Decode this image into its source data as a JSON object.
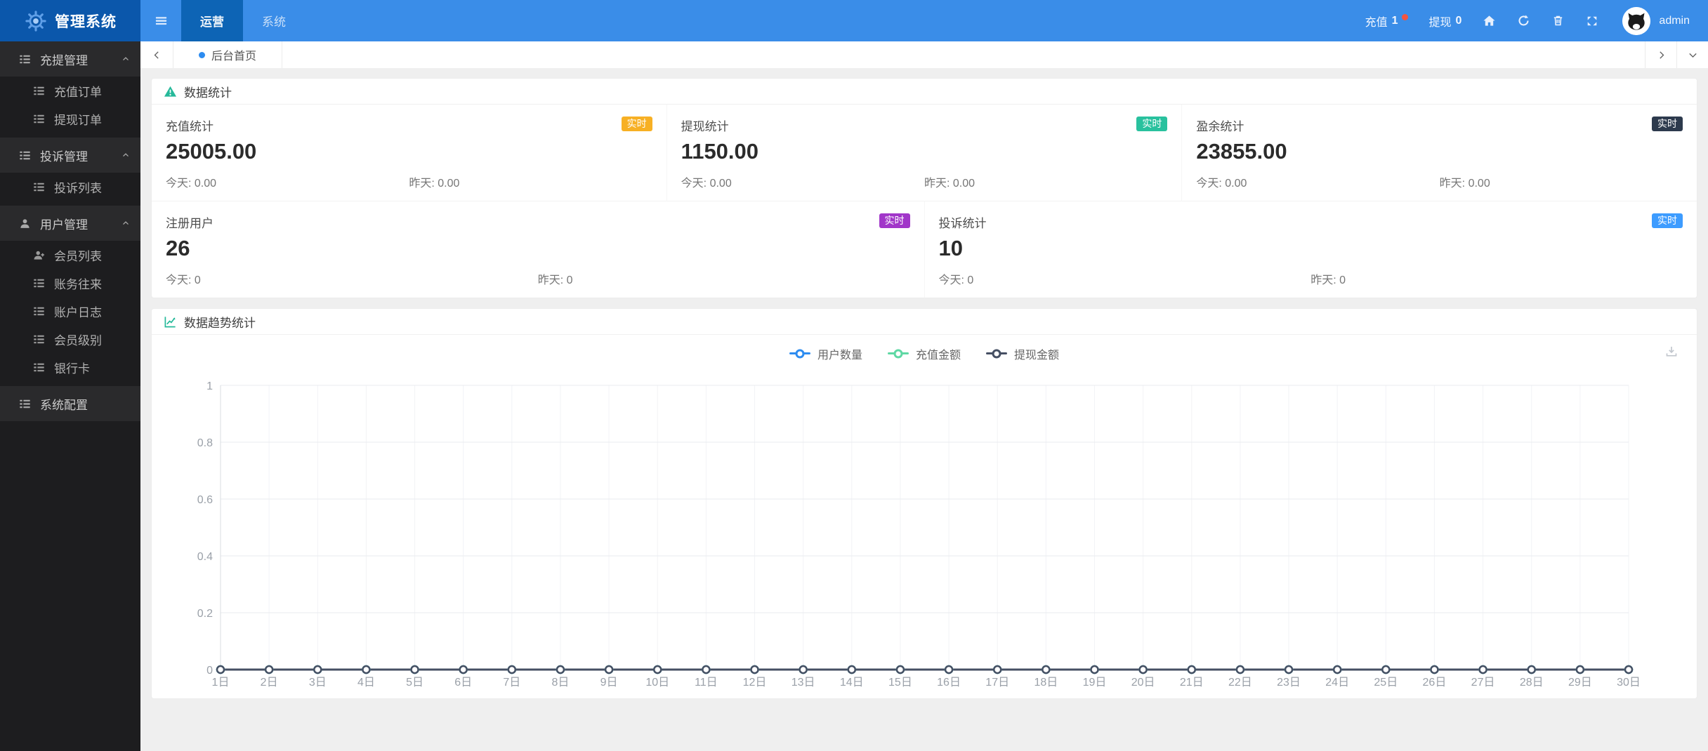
{
  "topbar": {
    "brand": "管理系统",
    "menu": [
      {
        "label": "运营",
        "active": true
      },
      {
        "label": "系统",
        "active": false
      }
    ],
    "recharge": {
      "label": "充值",
      "count": "1"
    },
    "withdraw": {
      "label": "提现",
      "count": "0"
    },
    "username": "admin"
  },
  "tabbar": {
    "active_tab": "后台首页"
  },
  "sidebar": {
    "sections": [
      {
        "label": "充提管理",
        "children": [
          {
            "label": "充值订单"
          },
          {
            "label": "提现订单"
          }
        ]
      },
      {
        "label": "投诉管理",
        "children": [
          {
            "label": "投诉列表"
          }
        ]
      },
      {
        "label": "用户管理",
        "children": [
          {
            "label": "会员列表"
          },
          {
            "label": "账务往来"
          },
          {
            "label": "账户日志"
          },
          {
            "label": "会员级别"
          },
          {
            "label": "银行卡"
          }
        ]
      },
      {
        "label": "系统配置",
        "children": []
      }
    ]
  },
  "stats_panel": {
    "title": "数据统计",
    "today_label": "今天:",
    "yesterday_label": "昨天:",
    "badge_label": "实时",
    "cards": [
      {
        "label": "充值统计",
        "value": "25005.00",
        "today": "0.00",
        "yesterday": "0.00",
        "badge_color": "#f7b024"
      },
      {
        "label": "提现统计",
        "value": "1150.00",
        "today": "0.00",
        "yesterday": "0.00",
        "badge_color": "#29c19e"
      },
      {
        "label": "盈余统计",
        "value": "23855.00",
        "today": "0.00",
        "yesterday": "0.00",
        "badge_color": "#2d3a4d"
      },
      {
        "label": "注册用户",
        "value": "26",
        "today": "0",
        "yesterday": "0",
        "badge_color": "#a136c9"
      },
      {
        "label": "投诉统计",
        "value": "10",
        "today": "0",
        "yesterday": "0",
        "badge_color": "#3d9cff"
      }
    ]
  },
  "chart_panel": {
    "title": "数据趋势统计"
  },
  "chart_data": {
    "type": "line",
    "title": "数据趋势统计",
    "categories": [
      "1日",
      "2日",
      "3日",
      "4日",
      "5日",
      "6日",
      "7日",
      "8日",
      "9日",
      "10日",
      "11日",
      "12日",
      "13日",
      "14日",
      "15日",
      "16日",
      "17日",
      "18日",
      "19日",
      "20日",
      "21日",
      "22日",
      "23日",
      "24日",
      "25日",
      "26日",
      "27日",
      "28日",
      "29日",
      "30日"
    ],
    "series": [
      {
        "name": "用户数量",
        "color": "#2d8cf0",
        "values": [
          0,
          0,
          0,
          0,
          0,
          0,
          0,
          0,
          0,
          0,
          0,
          0,
          0,
          0,
          0,
          0,
          0,
          0,
          0,
          0,
          0,
          0,
          0,
          0,
          0,
          0,
          0,
          0,
          0,
          0
        ]
      },
      {
        "name": "充值金额",
        "color": "#5fd8a4",
        "values": [
          0,
          0,
          0,
          0,
          0,
          0,
          0,
          0,
          0,
          0,
          0,
          0,
          0,
          0,
          0,
          0,
          0,
          0,
          0,
          0,
          0,
          0,
          0,
          0,
          0,
          0,
          0,
          0,
          0,
          0
        ]
      },
      {
        "name": "提现金额",
        "color": "#454f63",
        "values": [
          0,
          0,
          0,
          0,
          0,
          0,
          0,
          0,
          0,
          0,
          0,
          0,
          0,
          0,
          0,
          0,
          0,
          0,
          0,
          0,
          0,
          0,
          0,
          0,
          0,
          0,
          0,
          0,
          0,
          0
        ]
      }
    ],
    "xlabel": "",
    "ylabel": "",
    "ylim": [
      0,
      1
    ],
    "yticks": [
      0,
      0.2,
      0.4,
      0.6,
      0.8,
      1
    ],
    "grid": true,
    "legend_position": "top-center"
  }
}
